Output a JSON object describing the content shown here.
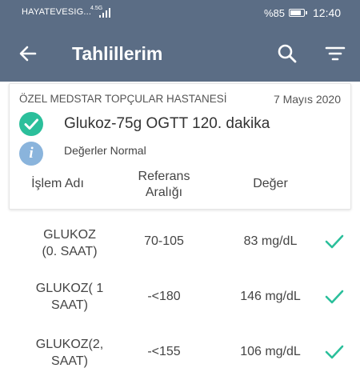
{
  "status_bar": {
    "carrier": "HAYATEVESIG...",
    "network": "4.5G",
    "battery_percent": "%85",
    "battery_level": 0.85,
    "time": "12:40"
  },
  "app_bar": {
    "title": "Tahlillerim",
    "back_icon": "arrow-left-icon",
    "search_icon": "search-icon",
    "filter_icon": "filter-icon"
  },
  "card": {
    "hospital": "ÖZEL MEDSTAR TOPÇULAR HASTANESİ",
    "date": "7 Mayıs 2020",
    "test_name": "Glukoz-75g OGTT 120. dakika",
    "status_text": "Değerler Normal",
    "info_glyph": "i",
    "columns": {
      "name": "İşlem Adı",
      "ref_line1": "Referans",
      "ref_line2": "Aralığı",
      "value": "Değer"
    }
  },
  "results": [
    {
      "name_line1": "GLUKOZ",
      "name_line2": "(0. SAAT)",
      "ref": "70-105",
      "value": "83 mg/dL",
      "status": "normal"
    },
    {
      "name_line1": "GLUKOZ( 1",
      "name_line2": "SAAT)",
      "ref": "-<180",
      "value": "146 mg/dL",
      "status": "normal"
    },
    {
      "name_line1": "GLUKOZ(2,",
      "name_line2": "SAAT)",
      "ref": "-<155",
      "value": "106 mg/dL",
      "status": "normal"
    }
  ],
  "colors": {
    "app_bar": "#5b6d85",
    "success": "#2bbf9b",
    "info": "#8ab4dc"
  }
}
